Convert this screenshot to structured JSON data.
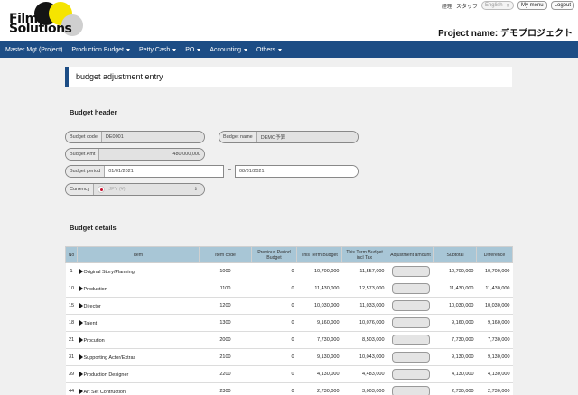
{
  "logo": {
    "line1": "Film",
    "line2": "Solutions"
  },
  "top_links": {
    "admin": "経理",
    "staff": "スタッフ",
    "language": "English",
    "my_menu": "My menu",
    "logout": "Logout"
  },
  "project": {
    "label": "Project name: デモプロジェクト"
  },
  "nav": [
    "Master Mgt (Project)",
    "Production Budget",
    "Petty Cash",
    "PO",
    "Accounting",
    "Others"
  ],
  "page_title": "budget adjustment entry",
  "budget_header": {
    "section_title": "Budget header",
    "budget_code_label": "Budget code",
    "budget_code": "DE0001",
    "budget_name_label": "Budget name",
    "budget_name": "DEMO予算",
    "budget_amt_label": "Budget Amt",
    "budget_amt": "480,000,000",
    "budget_period_label": "Budget period",
    "period_start": "01/01/2021",
    "period_sep": "~",
    "period_end": "08/31/2021",
    "currency_label": "Currency",
    "currency": "JPY (¥)"
  },
  "budget_details": {
    "section_title": "Budget details",
    "columns": [
      "No",
      "Item",
      "Item code",
      "Previous Period Budget",
      "This Term Budget",
      "This Term Budget incl Tax",
      "Adjustment amount",
      "Subtotal",
      "Difference"
    ],
    "rows": [
      {
        "no": "1",
        "item": "Original Story/Planning",
        "code": "1000",
        "prev": "0",
        "this": "10,700,000",
        "tax": "11,557,000",
        "subtotal": "10,700,000",
        "diff": "10,700,000"
      },
      {
        "no": "10",
        "item": "Production",
        "code": "1100",
        "prev": "0",
        "this": "11,430,000",
        "tax": "12,573,000",
        "subtotal": "11,430,000",
        "diff": "11,430,000"
      },
      {
        "no": "15",
        "item": "Director",
        "code": "1200",
        "prev": "0",
        "this": "10,030,000",
        "tax": "11,033,000",
        "subtotal": "10,030,000",
        "diff": "10,030,000"
      },
      {
        "no": "18",
        "item": "Talent",
        "code": "1300",
        "prev": "0",
        "this": "9,160,000",
        "tax": "10,076,000",
        "subtotal": "9,160,000",
        "diff": "9,160,000"
      },
      {
        "no": "21",
        "item": "Procution",
        "code": "2000",
        "prev": "0",
        "this": "7,730,000",
        "tax": "8,503,000",
        "subtotal": "7,730,000",
        "diff": "7,730,000"
      },
      {
        "no": "31",
        "item": "Supporting Actor/Extras",
        "code": "2100",
        "prev": "0",
        "this": "9,130,000",
        "tax": "10,043,000",
        "subtotal": "9,130,000",
        "diff": "9,130,000"
      },
      {
        "no": "39",
        "item": "Production Designer",
        "code": "2200",
        "prev": "0",
        "this": "4,130,000",
        "tax": "4,483,000",
        "subtotal": "4,130,000",
        "diff": "4,130,000"
      },
      {
        "no": "44",
        "item": "Art Set Contruction",
        "code": "2300",
        "prev": "0",
        "this": "2,730,000",
        "tax": "3,003,000",
        "subtotal": "2,730,000",
        "diff": "2,730,000"
      }
    ]
  },
  "colors": {
    "navbar": "#1d4d85",
    "table_header": "#a8c6d6",
    "logo_yellow": "#f5e400"
  }
}
